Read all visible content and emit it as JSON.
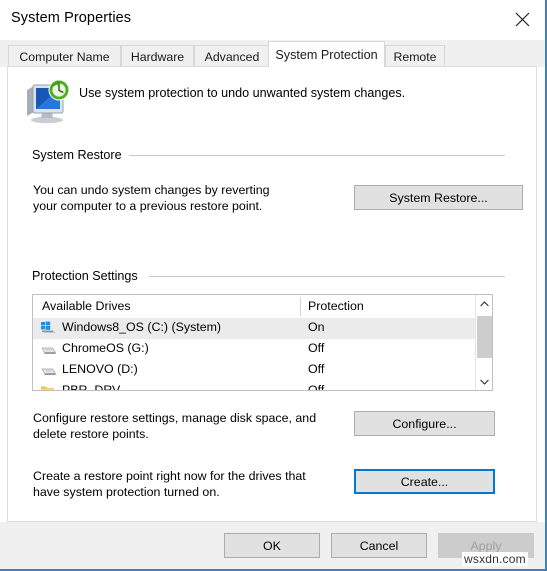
{
  "window": {
    "title": "System Properties",
    "close_icon": "close-icon"
  },
  "tabs": [
    {
      "label": "Computer Name",
      "active": false
    },
    {
      "label": "Hardware",
      "active": false
    },
    {
      "label": "Advanced",
      "active": false
    },
    {
      "label": "System Protection",
      "active": true
    },
    {
      "label": "Remote",
      "active": false
    }
  ],
  "header": {
    "icon": "system-protection-icon",
    "description": "Use system protection to undo unwanted system changes."
  },
  "system_restore": {
    "group_label": "System Restore",
    "description_line1": "You can undo system changes by reverting",
    "description_line2": "your computer to a previous restore point.",
    "button_label": "System Restore..."
  },
  "protection_settings": {
    "group_label": "Protection Settings",
    "columns": {
      "drives": "Available Drives",
      "protection": "Protection"
    },
    "rows": [
      {
        "name": "Windows8_OS (C:) (System)",
        "protection": "On",
        "icon": "windows-drive-icon",
        "selected": true
      },
      {
        "name": "ChromeOS (G:)",
        "protection": "Off",
        "icon": "hard-drive-icon",
        "selected": false
      },
      {
        "name": "LENOVO (D:)",
        "protection": "Off",
        "icon": "hard-drive-icon",
        "selected": false
      },
      {
        "name": "PBR_DRV",
        "protection": "Off",
        "icon": "folder-drive-icon",
        "selected": false
      }
    ],
    "configure": {
      "description_line1": "Configure restore settings, manage disk space, and",
      "description_line2": "delete restore points.",
      "button_label": "Configure..."
    },
    "create": {
      "description_line1": "Create a restore point right now for the drives that",
      "description_line2": "have system protection turned on.",
      "button_label": "Create..."
    }
  },
  "footer": {
    "ok_label": "OK",
    "cancel_label": "Cancel",
    "apply_label": "Apply"
  },
  "watermark": "wsxdn.com",
  "colors": {
    "accent": "#0078d7",
    "window_border": "#4a7ebb",
    "button_face": "#e1e1e1",
    "selection": "#ebebeb"
  }
}
